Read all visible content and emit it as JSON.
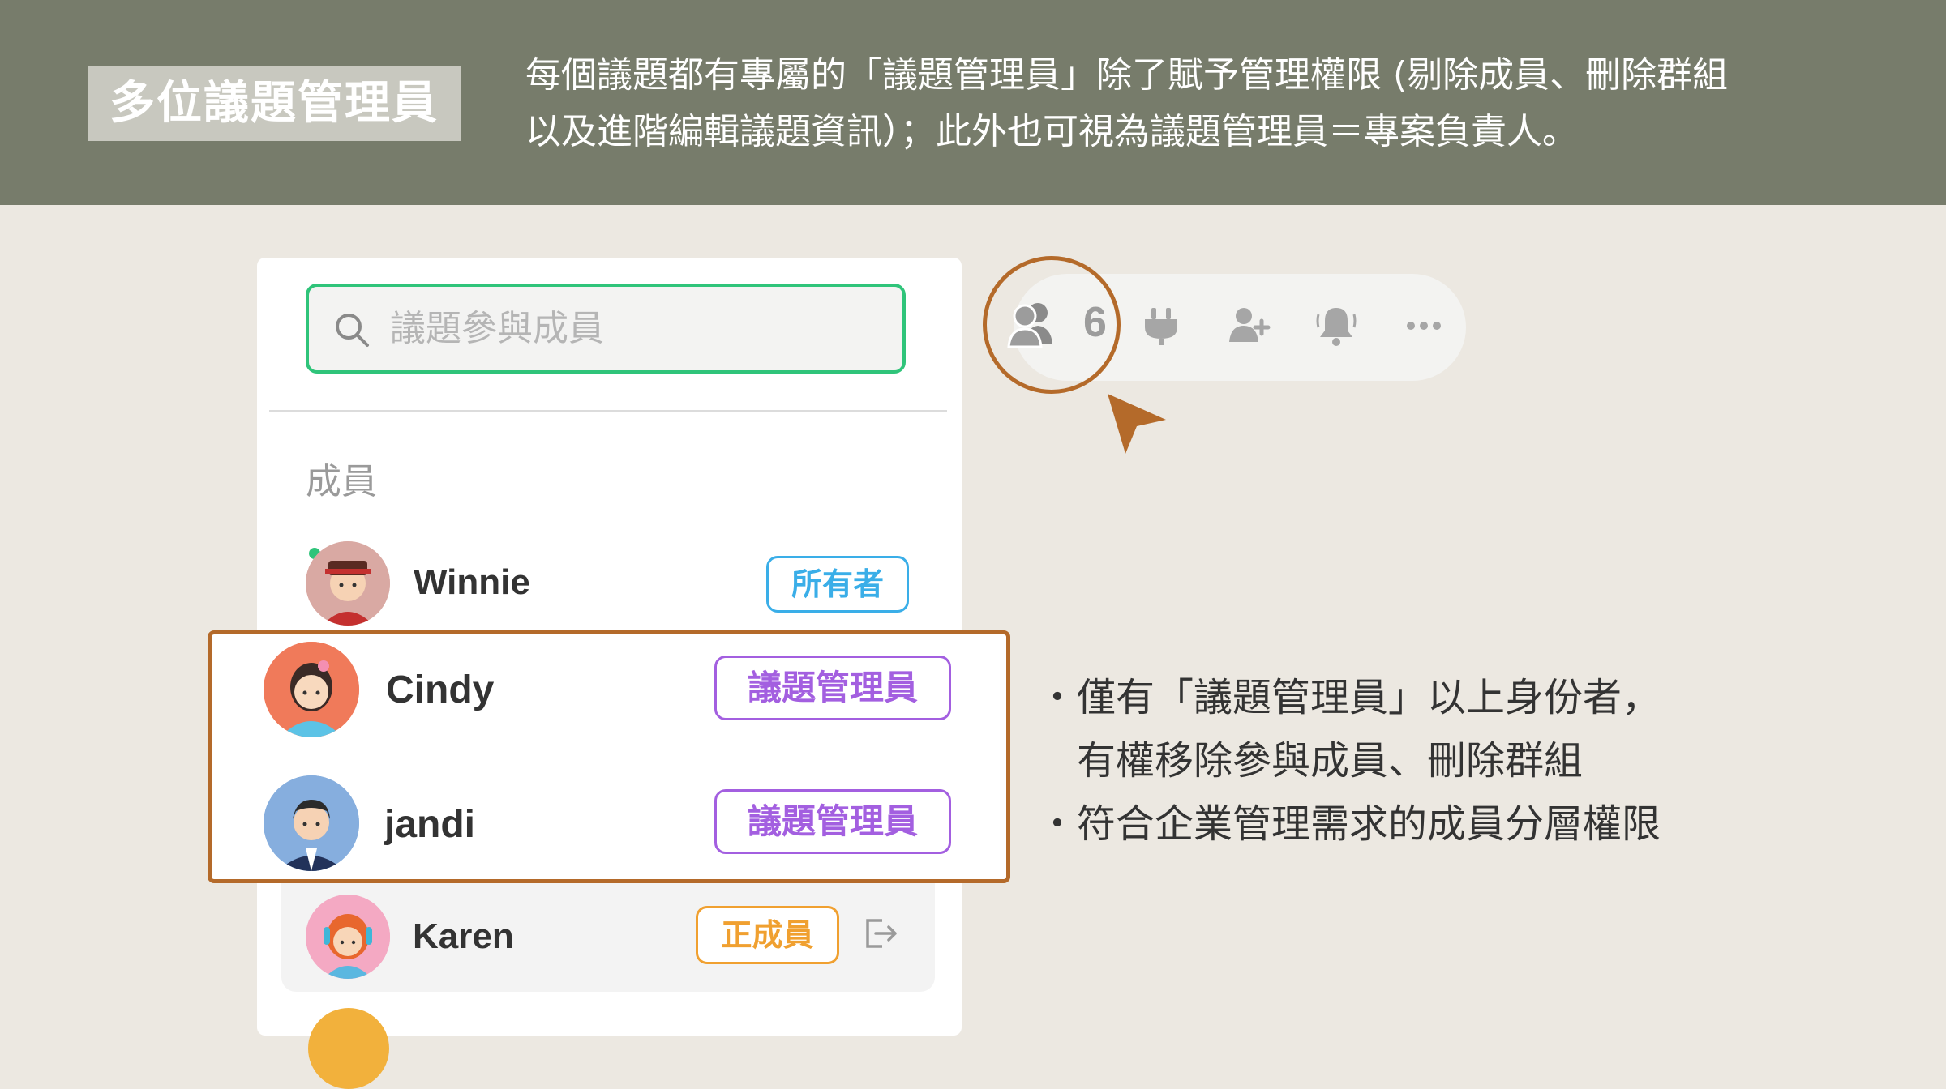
{
  "banner": {
    "title": "多位議題管理員",
    "desc_line1": "每個議題都有專屬的「議題管理員」除了賦予管理權限 (剔除成員、刪除群組",
    "desc_line2": "以及進階編輯議題資訊）；此外也可視為議題管理員＝專案負責人。"
  },
  "panel": {
    "search_placeholder": "議題參與成員",
    "section_label": "成員",
    "members": [
      {
        "name": "Winnie",
        "role": "所有者",
        "online": true
      },
      {
        "name": "Cindy",
        "role": "議題管理員"
      },
      {
        "name": "jandi",
        "role": "議題管理員"
      },
      {
        "name": "Karen",
        "role": "正成員"
      }
    ]
  },
  "toolbar": {
    "member_count": "6",
    "icons": [
      "members-icon",
      "plug-icon",
      "add-member-icon",
      "bell-icon",
      "more-icon"
    ]
  },
  "notes": {
    "bullet": "・",
    "line1": "僅有「議題管理員」以上身份者，",
    "line1_cont": "有權移除參與成員、刪除群組",
    "line2": "符合企業管理需求的成員分層權限"
  },
  "colors": {
    "banner_bg": "#777c6b",
    "page_bg": "#ece8e1",
    "search_border": "#2fc47a",
    "highlight": "#b46a2a",
    "owner_badge": "#3aaee8",
    "admin_badge": "#a35fe0",
    "member_badge": "#f0a030"
  }
}
